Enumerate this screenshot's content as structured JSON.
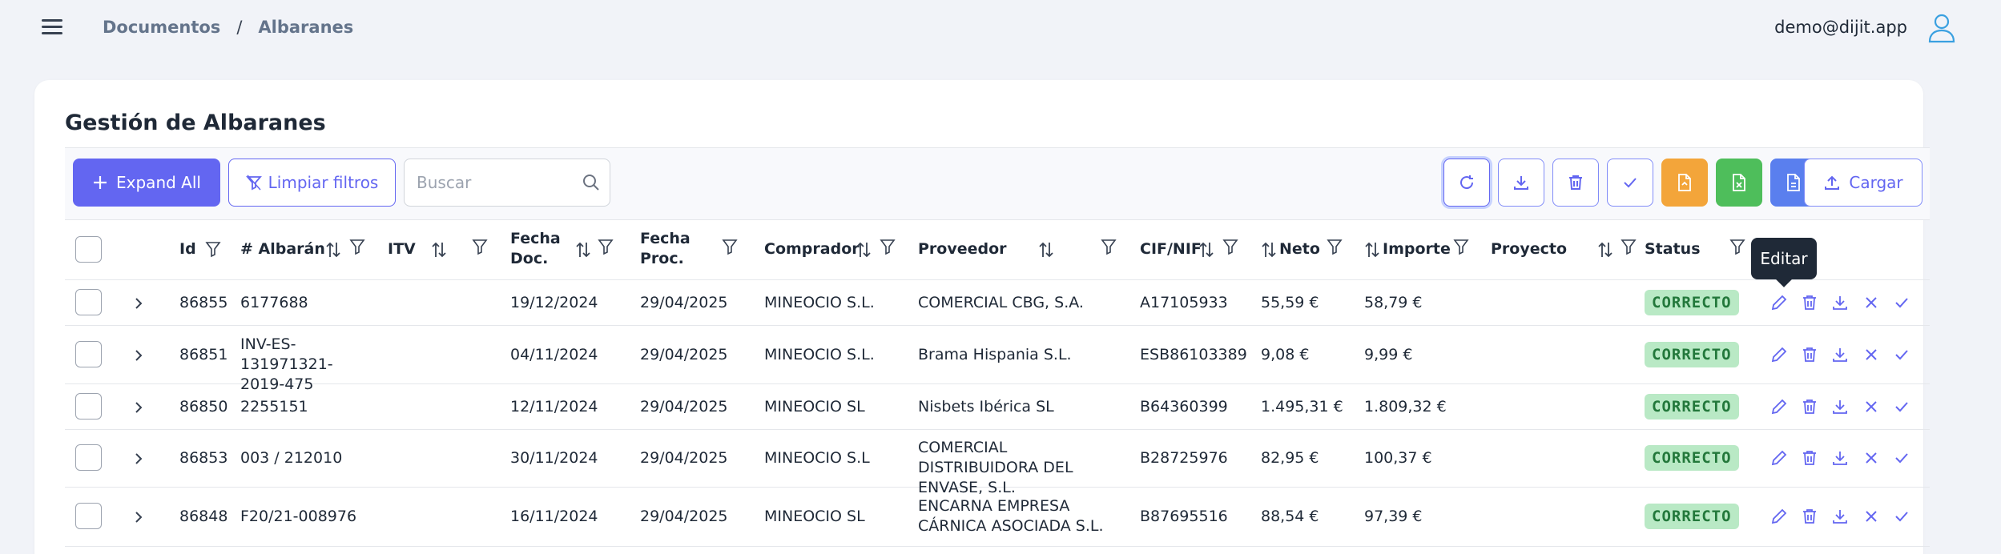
{
  "header": {
    "breadcrumb": [
      "Documentos",
      "Albaranes"
    ],
    "breadcrumb_sep": "/",
    "user_email": "demo@dijit.app"
  },
  "page": {
    "title": "Gestión de Albaranes"
  },
  "toolbar": {
    "expand_label": "Expand All",
    "clear_filters_label": "Limpiar filtros",
    "search_placeholder": "Buscar",
    "upload_label": "Cargar",
    "icon_buttons": [
      "refresh-icon",
      "download-icon",
      "trash-icon",
      "check-icon",
      "file-pdf-icon",
      "file-excel-icon",
      "file-doc-icon"
    ]
  },
  "table": {
    "columns": {
      "id": "Id",
      "albaran": "# Albarán",
      "itv": "ITV",
      "fecha_doc": "Fecha Doc.",
      "fecha_proc": "Fecha Proc.",
      "comprador": "Comprador",
      "proveedor": "Proveedor",
      "cif": "CIF/NIF",
      "neto": "Neto",
      "importe": "Importe",
      "proyecto": "Proyecto",
      "status": "Status"
    },
    "rows": [
      {
        "id": "86855",
        "albaran": "6177688",
        "itv": "",
        "fecha_doc": "19/12/2024",
        "fecha_proc": "29/04/2025",
        "comprador": "MINEOCIO S.L.",
        "proveedor": "COMERCIAL CBG, S.A.",
        "cif": "A17105933",
        "neto": "55,59 €",
        "importe": "58,79 €",
        "proyecto": "",
        "status": "CORRECTO"
      },
      {
        "id": "86851",
        "albaran": "INV-ES-131971321-2019-475",
        "itv": "",
        "fecha_doc": "04/11/2024",
        "fecha_proc": "29/04/2025",
        "comprador": "MINEOCIO S.L.",
        "proveedor": "Brama Hispania S.L.",
        "cif": "ESB86103389",
        "neto": "9,08 €",
        "importe": "9,99 €",
        "proyecto": "",
        "status": "CORRECTO"
      },
      {
        "id": "86850",
        "albaran": "2255151",
        "itv": "",
        "fecha_doc": "12/11/2024",
        "fecha_proc": "29/04/2025",
        "comprador": "MINEOCIO SL",
        "proveedor": "Nisbets Ibérica SL",
        "cif": "B64360399",
        "neto": "1.495,31 €",
        "importe": "1.809,32 €",
        "proyecto": "",
        "status": "CORRECTO"
      },
      {
        "id": "86853",
        "albaran": "003 / 212010",
        "itv": "",
        "fecha_doc": "30/11/2024",
        "fecha_proc": "29/04/2025",
        "comprador": "MINEOCIO S.L",
        "proveedor": "COMERCIAL DISTRIBUIDORA DEL ENVASE, S.L.",
        "cif": "B28725976",
        "neto": "82,95 €",
        "importe": "100,37 €",
        "proyecto": "",
        "status": "CORRECTO"
      },
      {
        "id": "86848",
        "albaran": "F20/21-008976",
        "itv": "",
        "fecha_doc": "16/11/2024",
        "fecha_proc": "29/04/2025",
        "comprador": "MINEOCIO SL",
        "proveedor": "ENCARNA EMPRESA CÁRNICA ASOCIADA S.L.",
        "cif": "B87695516",
        "neto": "88,54 €",
        "importe": "97,39 €",
        "proyecto": "",
        "status": "CORRECTO"
      }
    ]
  },
  "tooltip": {
    "text": "Editar"
  },
  "colors": {
    "accent": "#6366f1",
    "status_bg": "#b9e9c5",
    "status_fg": "#23783b"
  }
}
